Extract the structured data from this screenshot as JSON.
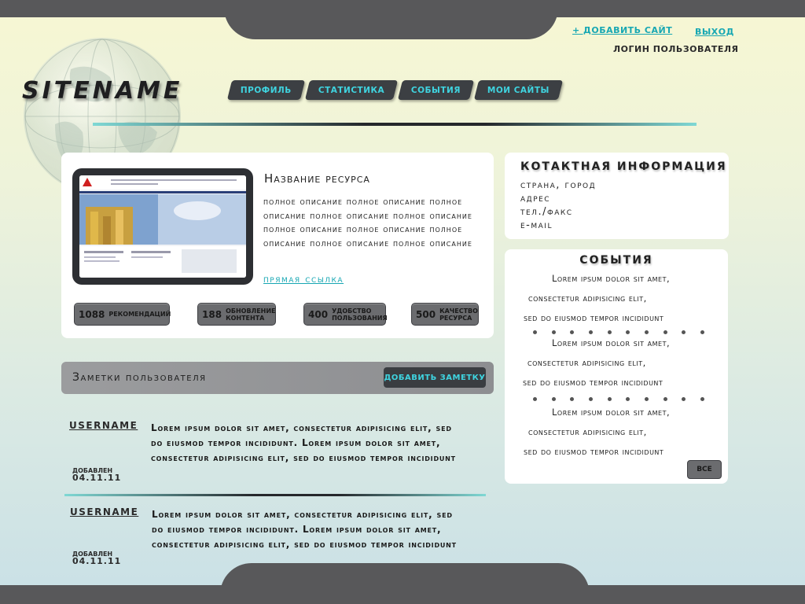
{
  "header": {
    "logo": "SITENAME",
    "add_site": "+ ДОБАВИТЬ САЙТ",
    "logout": "ВЫХОД",
    "login_user": "ЛОГИН ПОЛЬЗОВАТЕЛЯ"
  },
  "nav": [
    "ПРОФИЛЬ",
    "СТАТИСТИКА",
    "СОБЫТИЯ",
    "МОИ САЙТЫ"
  ],
  "resource": {
    "title": "Название ресурса",
    "description": "полное описание полное описание полное описание полное описание полное описание полное описание полное описание полное описание полное описание полное описание",
    "link": "прямая ссылка",
    "stats": [
      {
        "num": "1088",
        "label": "РЕКОМЕНДАЦИЙ"
      },
      {
        "num": "188",
        "label": "ОБНОВЛЕНИЕ КОНТЕНТА"
      },
      {
        "num": "400",
        "label": "УДОБСТВО ПОЛЬЗОВАНИЯ"
      },
      {
        "num": "500",
        "label": "КАЧЕСТВО РЕСУРСА"
      }
    ]
  },
  "contact": {
    "title": "КОТАКТНАЯ ИНФОРМАЦИЯ",
    "country": "страна, город",
    "address": "адрес",
    "phone": "тел./факс",
    "email": "e-mail"
  },
  "events": {
    "title": "СОБЫТИЯ",
    "items": [
      {
        "l1": "Lorem ipsum dolor sit amet,",
        "l2": "consectetur adipisicing elit,",
        "l3": "sed do eiusmod tempor incididunt"
      },
      {
        "l1": "Lorem ipsum dolor sit amet,",
        "l2": "consectetur adipisicing elit,",
        "l3": "sed do eiusmod tempor incididunt"
      },
      {
        "l1": "Lorem ipsum dolor sit amet,",
        "l2": "consectetur adipisicing elit,",
        "l3": "sed do eiusmod tempor incididunt"
      }
    ],
    "all_button": "ВСЕ"
  },
  "notes": {
    "title": "Заметки пользователя",
    "add_button": "ДОБАВИТЬ ЗАМЕТКУ",
    "items": [
      {
        "user": "USERNAME",
        "l1": "Lorem ipsum dolor sit amet, consectetur adipisicing elit, sed",
        "l2": "do eiusmod tempor incididunt. Lorem ipsum dolor sit amet,",
        "l3": "consectetur adipisicing elit, sed do eiusmod tempor incididunt",
        "added_label": "ДОБАВЛЕН",
        "date": "04.11.11"
      },
      {
        "user": "USERNAME",
        "l1": "Lorem ipsum dolor sit amet, consectetur adipisicing elit, sed",
        "l2": "do eiusmod tempor incididunt. Lorem ipsum dolor sit amet,",
        "l3": "consectetur adipisicing elit, sed do eiusmod tempor incididunt",
        "added_label": "ДОБАВЛЕН",
        "date": "04.11.11"
      }
    ]
  },
  "colors": {
    "accent": "#17a7b3",
    "nav_text": "#3fd4e0",
    "dark_chrome": "#58585a",
    "button_gray": "#6b6c6f"
  }
}
